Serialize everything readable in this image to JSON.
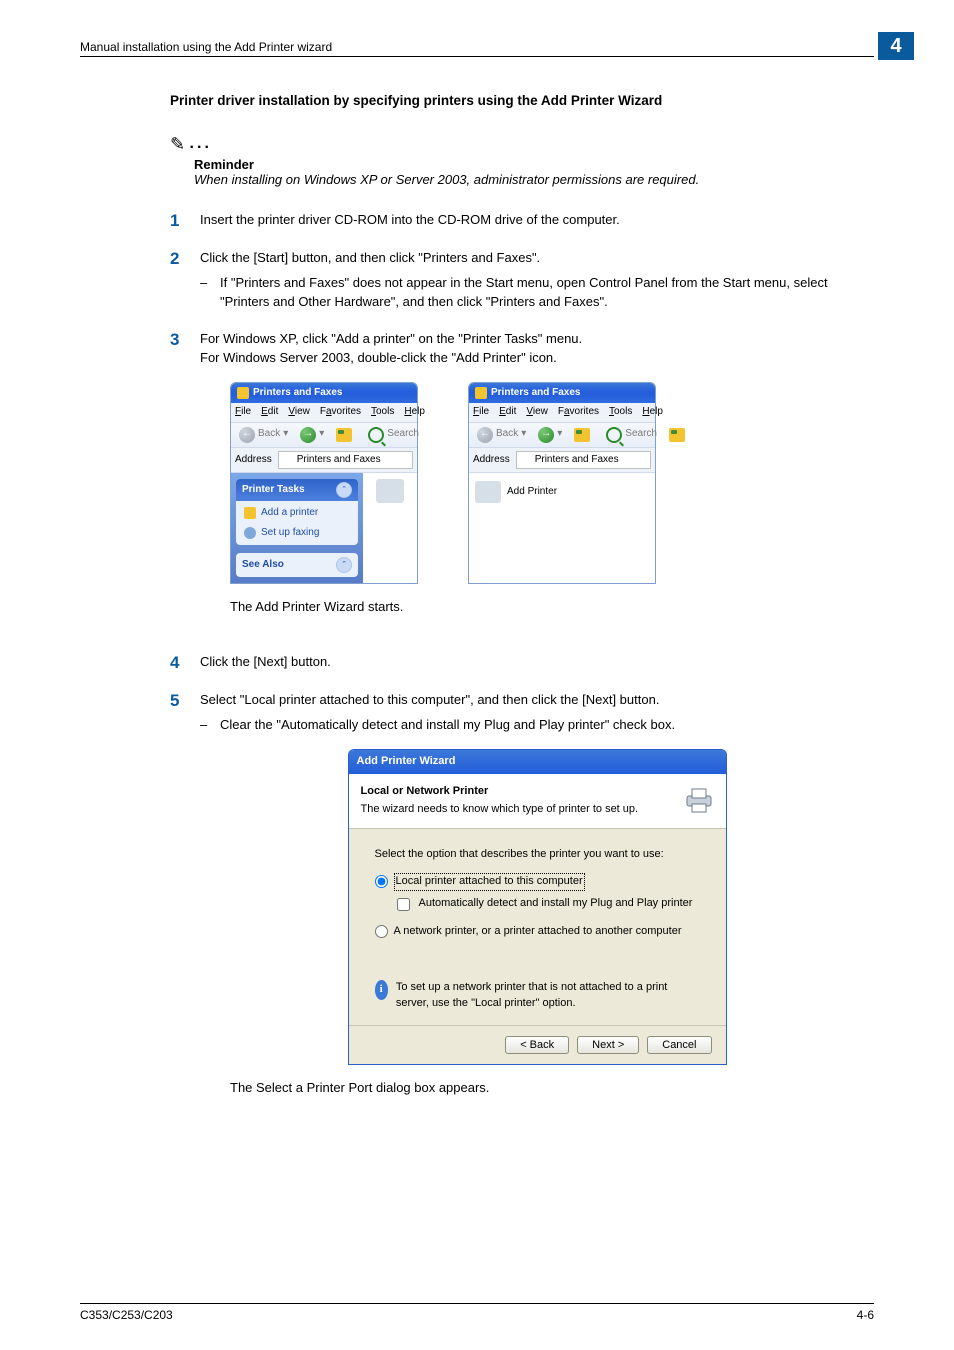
{
  "header": {
    "breadcrumb": "Manual installation using the Add Printer wizard",
    "chapter": "4"
  },
  "section_title": "Printer driver installation by specifying printers using the Add Printer Wizard",
  "reminder": {
    "title": "Reminder",
    "text": "When installing on Windows XP or Server 2003, administrator permissions are required."
  },
  "steps": {
    "s1_num": "1",
    "s1": "Insert the printer driver CD-ROM into the CD-ROM drive of the computer.",
    "s2_num": "2",
    "s2": "Click the [Start] button, and then click \"Printers and Faxes\".",
    "s2_sub": "If \"Printers and Faxes\" does not appear in the Start menu, open Control Panel from the Start menu, select \"Printers and Other Hardware\", and then click \"Printers and Faxes\".",
    "s3_num": "3",
    "s3a": "For Windows XP, click \"Add a printer\" on the \"Printer Tasks\" menu.",
    "s3b": "For Windows Server 2003, double-click the \"Add Printer\" icon.",
    "s3_result": "The Add Printer Wizard starts.",
    "s4_num": "4",
    "s4": "Click the [Next] button.",
    "s5_num": "5",
    "s5": "Select \"Local printer attached to this computer\", and then click the [Next] button.",
    "s5_sub": "Clear the \"Automatically detect and install my Plug and Play printer\" check box.",
    "s5_result": "The Select a Printer Port dialog box appears."
  },
  "xp_window": {
    "title": "Printers and Faxes",
    "menu": {
      "file": "File",
      "edit": "Edit",
      "view": "View",
      "favorites": "Favorites",
      "tools": "Tools",
      "help": "Help"
    },
    "toolbar": {
      "back": "Back",
      "search": "Search"
    },
    "address_label": "Address",
    "address_value": "Printers and Faxes",
    "tasks_header": "Printer Tasks",
    "task_add": "Add a printer",
    "task_fax": "Set up faxing",
    "see_also": "See Also",
    "add_printer_item": "Add Printer"
  },
  "wizard": {
    "title": "Add Printer Wizard",
    "header_bold": "Local or Network Printer",
    "header_sub": "The wizard needs to know which type of printer to set up.",
    "prompt": "Select the option that describes the printer you want to use:",
    "opt_local": "Local printer attached to this computer",
    "opt_auto": "Automatically detect and install my Plug and Play printer",
    "opt_network": "A network printer, or a printer attached to another computer",
    "info": "To set up a network printer that is not attached to a print server, use the \"Local printer\" option.",
    "btn_back": "< Back",
    "btn_next": "Next >",
    "btn_cancel": "Cancel"
  },
  "footer": {
    "model": "C353/C253/C203",
    "page": "4-6"
  }
}
